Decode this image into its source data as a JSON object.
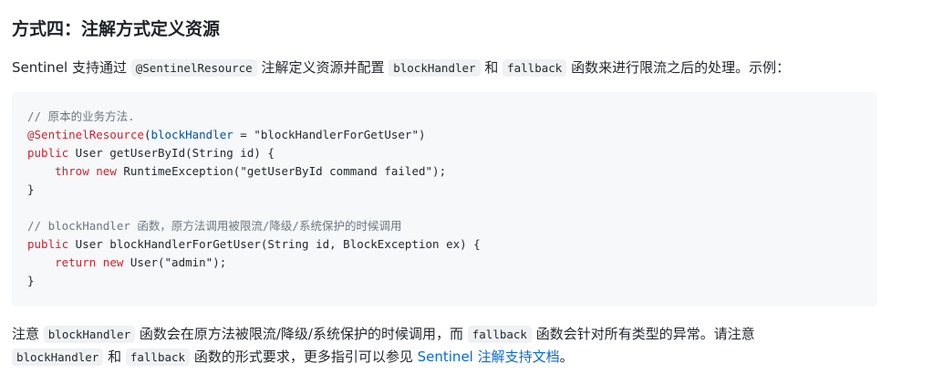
{
  "heading": "方式四：注解方式定义资源",
  "intro": {
    "prefix": "Sentinel 支持通过 ",
    "annotation_code": "@SentinelResource",
    "middle": " 注解定义资源并配置 ",
    "block_handler_code": "blockHandler",
    "and": " 和 ",
    "fallback_code": "fallback",
    "suffix": " 函数来进行限流之后的处理。示例："
  },
  "code": {
    "line1_comment": "// 原本的业务方法.",
    "line2_annotation": "@SentinelResource",
    "line2_open": "(",
    "line2_param": "blockHandler",
    "line2_eq": " = ",
    "line2_value": "\"blockHandlerForGetUser\"",
    "line2_close": ")",
    "line3_kw": "public",
    "line3_rest": " User getUserById(String id) {",
    "line4_indent": "    ",
    "line4_kw1": "throw",
    "line4_space": " ",
    "line4_kw2": "new",
    "line4_rest": " RuntimeException(\"getUserById command failed\");",
    "line5": "}",
    "line7_comment": "// blockHandler 函数，原方法调用被限流/降级/系统保护的时候调用",
    "line8_kw": "public",
    "line8_rest": " User blockHandlerForGetUser(String id, BlockException ex) {",
    "line9_indent": "    ",
    "line9_kw1": "return",
    "line9_space": " ",
    "line9_kw2": "new",
    "line9_rest": " User(\"admin\");",
    "line10": "}"
  },
  "note": {
    "prefix": "注意 ",
    "block_handler_code": "blockHandler",
    "middle": " 函数会在原方法被限流/降级/系统保护的时候调用，而 ",
    "fallback_code": "fallback",
    "suffix": " 函数会针对所有类型的异常。请注意",
    "line2_block_handler_code": "blockHandler",
    "line2_and": " 和 ",
    "line2_fallback_code": "fallback",
    "line2_middle": " 函数的形式要求，更多指引可以参见 ",
    "link_text": "Sentinel 注解支持文档",
    "line2_end": "。"
  }
}
